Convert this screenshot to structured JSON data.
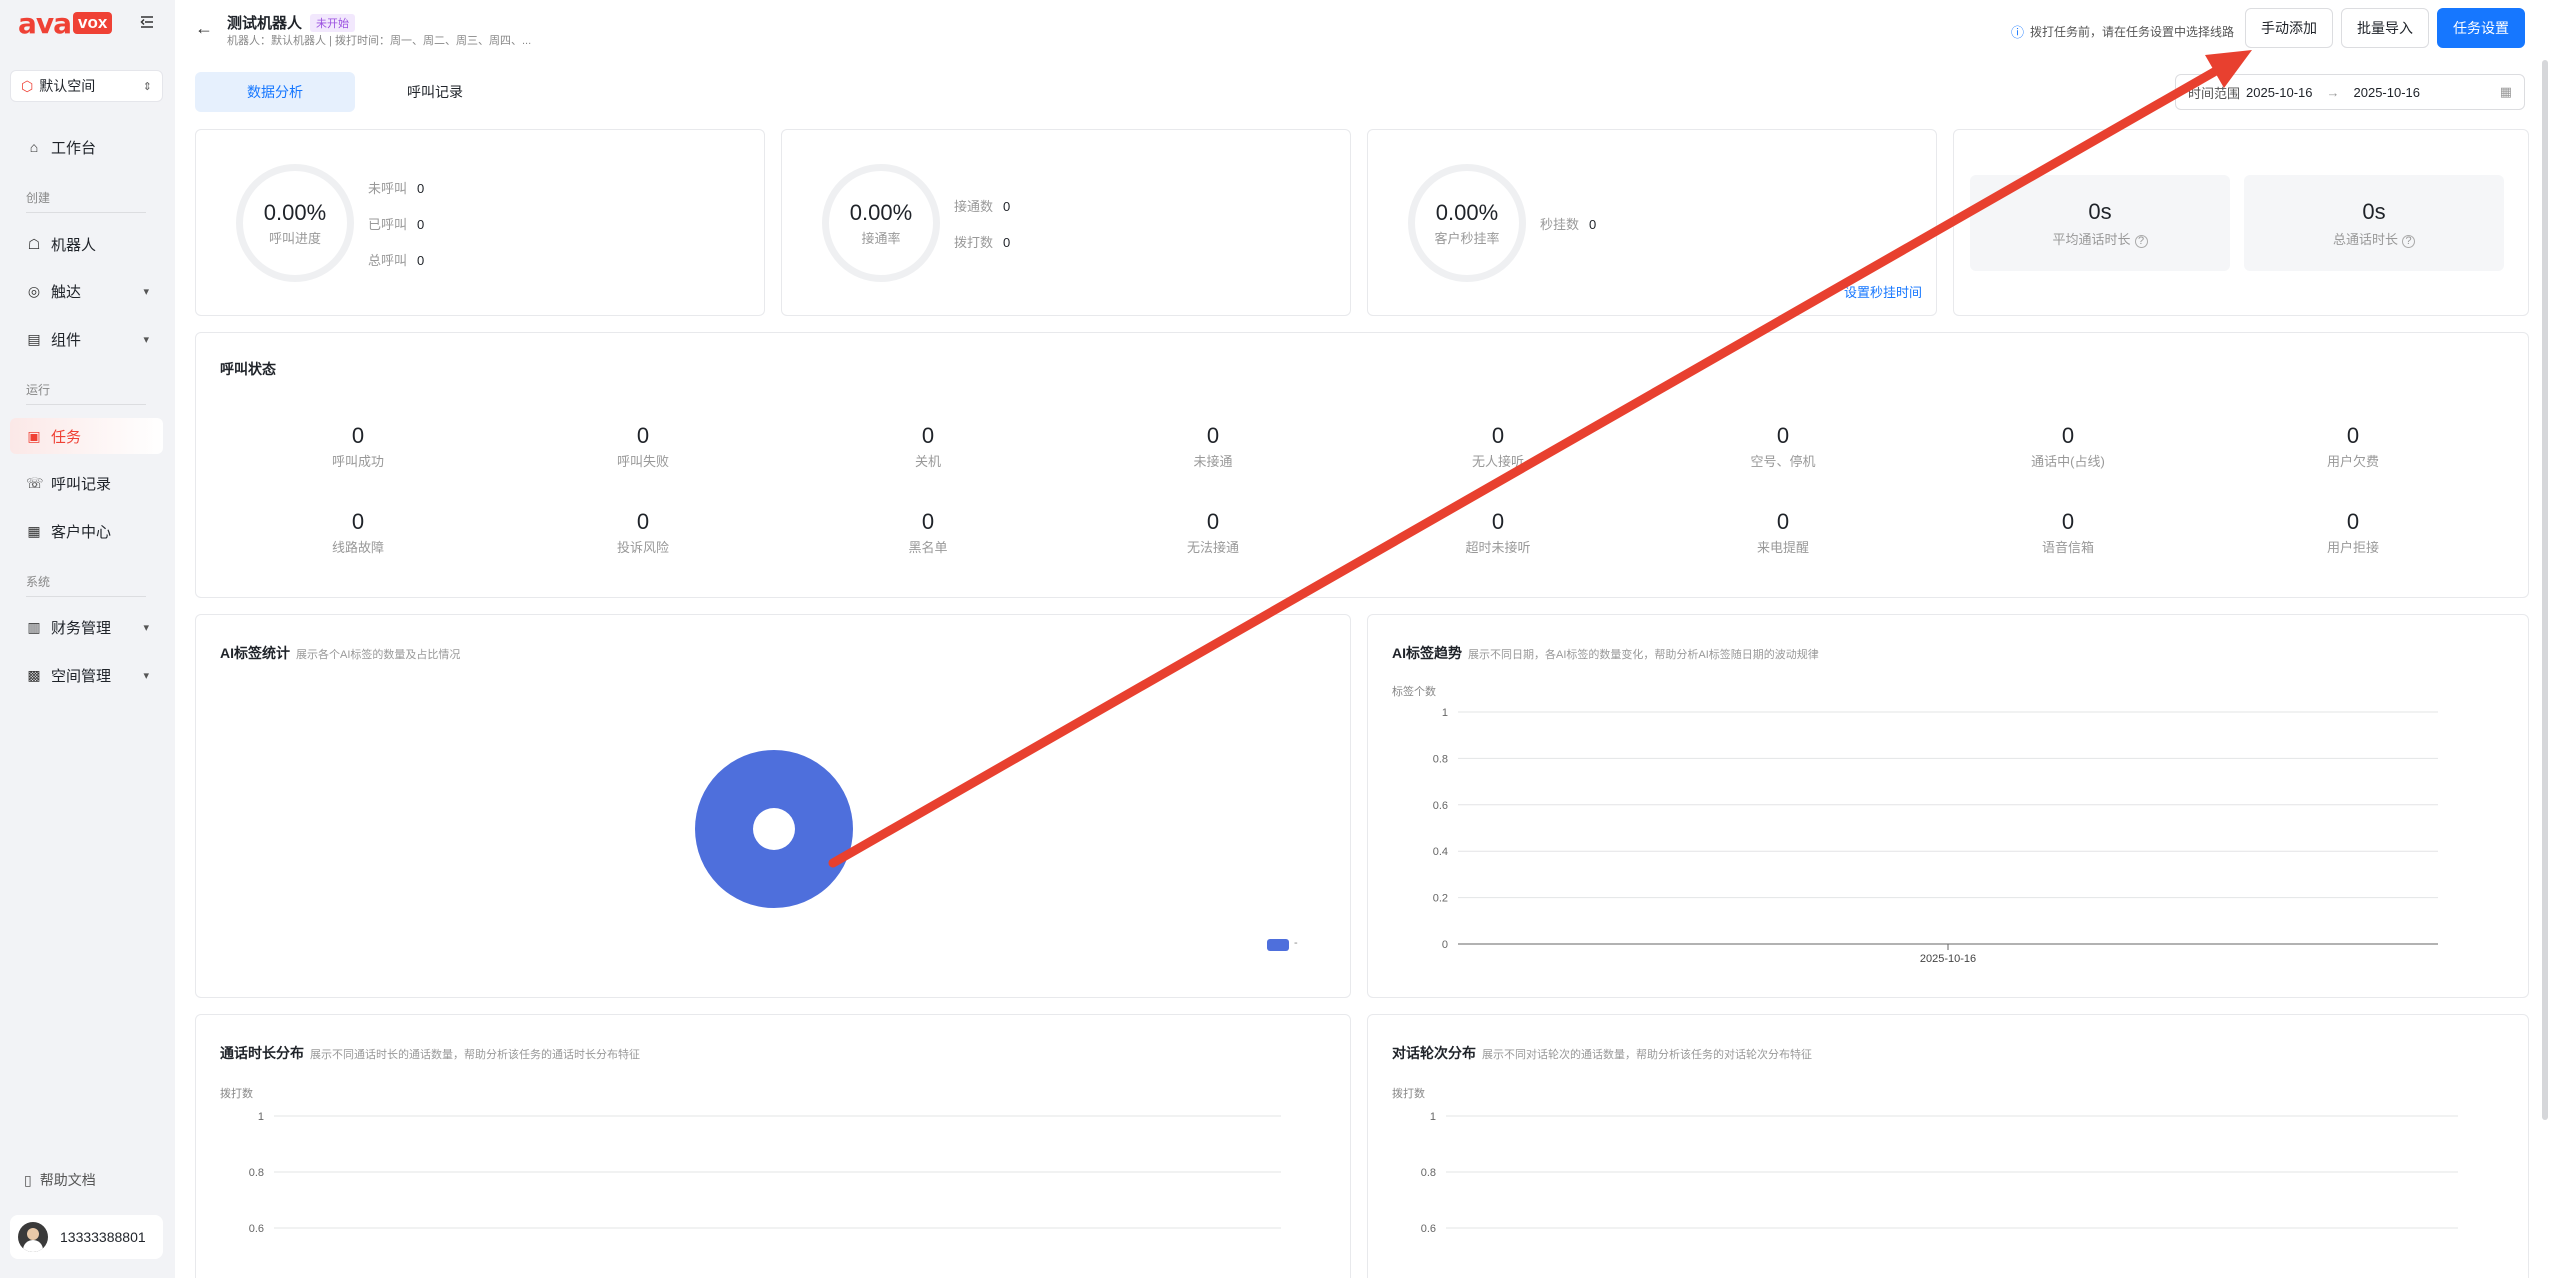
{
  "brand": {
    "logo_ava": "ava",
    "logo_vox": "vox"
  },
  "sidebar": {
    "space": "默认空间",
    "items": [
      {
        "label": "工作台",
        "icon": "home-icon"
      },
      {
        "label": "机器人",
        "icon": "robot-icon"
      },
      {
        "label": "触达",
        "icon": "reach-icon"
      },
      {
        "label": "组件",
        "icon": "component-icon"
      },
      {
        "label": "任务",
        "icon": "task-icon"
      },
      {
        "label": "呼叫记录",
        "icon": "phone-icon"
      },
      {
        "label": "客户中心",
        "icon": "customer-icon"
      },
      {
        "label": "财务管理",
        "icon": "finance-icon"
      },
      {
        "label": "空间管理",
        "icon": "space-icon"
      }
    ],
    "sections": {
      "create": "创建",
      "run": "运行",
      "system": "系统"
    },
    "help": "帮助文档",
    "user": "13333388801"
  },
  "header": {
    "title": "测试机器人",
    "status": "未开始",
    "subtitle": "机器人：默认机器人  |  拨打时间：周一、周二、周三、周四、...",
    "notice": "拨打任务前，请在任务设置中选择线路",
    "btn_manual_add": "手动添加",
    "btn_batch_import": "批量导入",
    "btn_task_settings": "任务设置"
  },
  "tabs": [
    {
      "label": "数据分析",
      "active": true
    },
    {
      "label": "呼叫记录",
      "active": false
    }
  ],
  "date_range": {
    "label": "时间范围",
    "start": "2025-10-16",
    "end": "2025-10-16"
  },
  "summary": {
    "progress": {
      "value": "0.00%",
      "label": "呼叫进度",
      "items": [
        {
          "k": "未呼叫",
          "v": "0"
        },
        {
          "k": "已呼叫",
          "v": "0"
        },
        {
          "k": "总呼叫",
          "v": "0"
        }
      ]
    },
    "connect": {
      "value": "0.00%",
      "label": "接通率",
      "items": [
        {
          "k": "接通数",
          "v": "0"
        },
        {
          "k": "拨打数",
          "v": "0"
        }
      ]
    },
    "hangup": {
      "value": "0.00%",
      "label": "客户秒挂率",
      "items": [
        {
          "k": "秒挂数",
          "v": "0"
        }
      ],
      "link": "设置秒挂时间"
    },
    "duration": {
      "avg_value": "0s",
      "avg_label": "平均通话时长",
      "total_value": "0s",
      "total_label": "总通话时长"
    }
  },
  "call_status": {
    "title": "呼叫状态",
    "stats": [
      {
        "n": "0",
        "t": "呼叫成功"
      },
      {
        "n": "0",
        "t": "呼叫失败"
      },
      {
        "n": "0",
        "t": "关机"
      },
      {
        "n": "0",
        "t": "未接通"
      },
      {
        "n": "0",
        "t": "无人接听"
      },
      {
        "n": "0",
        "t": "空号、停机"
      },
      {
        "n": "0",
        "t": "通话中(占线)"
      },
      {
        "n": "0",
        "t": "用户欠费"
      },
      {
        "n": "0",
        "t": "线路故障"
      },
      {
        "n": "0",
        "t": "投诉风险"
      },
      {
        "n": "0",
        "t": "黑名单"
      },
      {
        "n": "0",
        "t": "无法接通"
      },
      {
        "n": "0",
        "t": "超时未接听"
      },
      {
        "n": "0",
        "t": "来电提醒"
      },
      {
        "n": "0",
        "t": "语音信箱"
      },
      {
        "n": "0",
        "t": "用户拒接"
      }
    ]
  },
  "ai_tag_stats": {
    "title": "AI标签统计",
    "hint": "展示各个AI标签的数量及占比情况",
    "legend": "-",
    "color": "#4e6fdc"
  },
  "ai_tag_trend": {
    "title": "AI标签趋势",
    "hint": "展示不同日期，各AI标签的数量变化，帮助分析AI标签随日期的波动规律",
    "ylabel": "标签个数"
  },
  "duration_dist": {
    "title": "通话时长分布",
    "hint": "展示不同通话时长的通话数量，帮助分析该任务的通话时长分布特征",
    "ylabel": "拨打数"
  },
  "round_dist": {
    "title": "对话轮次分布",
    "hint": "展示不同对话轮次的通话数量，帮助分析该任务的对话轮次分布特征",
    "ylabel": "拨打数"
  },
  "chart_data": [
    {
      "type": "pie",
      "title": "AI标签统计",
      "categories": [
        "-"
      ],
      "values": [
        1
      ]
    },
    {
      "type": "line",
      "title": "AI标签趋势",
      "ylabel": "标签个数",
      "x": [
        "2025-10-16"
      ],
      "ylim": [
        0,
        1
      ],
      "yticks": [
        "1",
        "0.8",
        "0.6",
        "0.4",
        "0.2",
        "0"
      ],
      "grid": true
    },
    {
      "type": "bar",
      "title": "通话时长分布",
      "ylabel": "拨打数",
      "ylim": [
        0,
        1
      ],
      "yticks": [
        "1",
        "0.8",
        "0.6"
      ],
      "grid": true
    },
    {
      "type": "bar",
      "title": "对话轮次分布",
      "ylabel": "拨打数",
      "ylim": [
        0,
        1
      ],
      "yticks": [
        "1",
        "0.8",
        "0.6"
      ],
      "grid": true
    }
  ],
  "colors": {
    "accent": "#1677ff",
    "brand": "#ef4135",
    "annotation_arrow": "#e8402f"
  }
}
